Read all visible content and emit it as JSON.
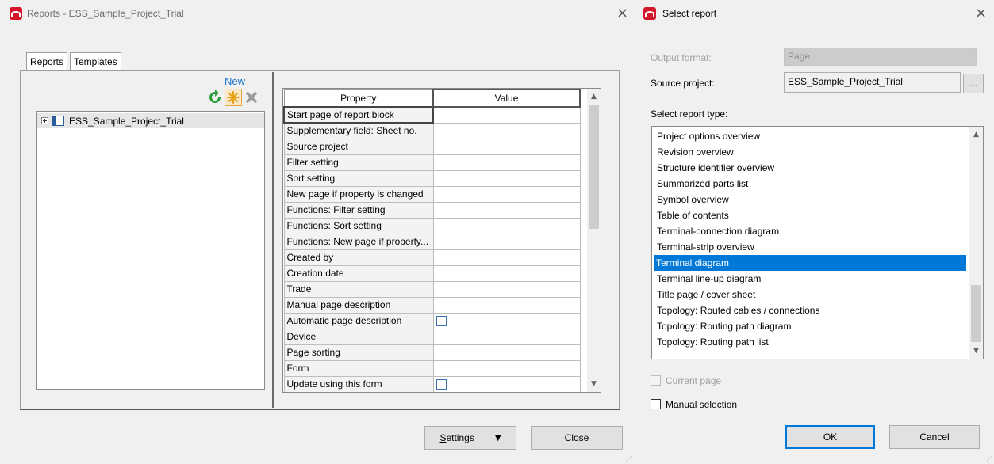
{
  "left_window": {
    "title": "Reports - ESS_Sample_Project_Trial",
    "close_glyph": "×",
    "tabs": [
      "Reports",
      "Templates"
    ],
    "toolbar": {
      "new_label": "New",
      "icons": [
        "refresh-icon",
        "new-star-icon",
        "delete-icon"
      ]
    },
    "tree": {
      "items": [
        {
          "label": "ESS_Sample_Project_Trial",
          "expand_glyph": "plus-box-icon",
          "icon": "project-icon"
        }
      ]
    },
    "grid": {
      "headers": [
        "Property",
        "Value"
      ],
      "rows": [
        {
          "property": "Start page of report block",
          "value": ""
        },
        {
          "property": "Supplementary field: Sheet no.",
          "value": ""
        },
        {
          "property": "Source project",
          "value": ""
        },
        {
          "property": "Filter setting",
          "value": ""
        },
        {
          "property": "Sort setting",
          "value": ""
        },
        {
          "property": "New page if property is changed",
          "value": ""
        },
        {
          "property": "Functions: Filter setting",
          "value": ""
        },
        {
          "property": "Functions: Sort setting",
          "value": ""
        },
        {
          "property": "Functions: New page if property...",
          "value": ""
        },
        {
          "property": "Created by",
          "value": ""
        },
        {
          "property": "Creation date",
          "value": ""
        },
        {
          "property": "Trade",
          "value": ""
        },
        {
          "property": "Manual page description",
          "value": ""
        },
        {
          "property": "Automatic page description",
          "value": "checkbox"
        },
        {
          "property": "Device",
          "value": ""
        },
        {
          "property": "Page sorting",
          "value": ""
        },
        {
          "property": "Form",
          "value": ""
        },
        {
          "property": "Update using this form",
          "value": "checkbox"
        }
      ]
    },
    "buttons": {
      "settings": "Settings",
      "settings_mnemonic": "S",
      "settings_rest": "ettings",
      "settings_arrow": "▼",
      "close": "Close"
    }
  },
  "right_window": {
    "title": "Select report",
    "close_glyph": "×",
    "output_format_label": "Output format:",
    "output_format_value": "Page",
    "source_project_label": "Source project:",
    "source_project_value": "ESS_Sample_Project_Trial",
    "browse_label": "...",
    "report_type_label": "Select report type:",
    "report_types": [
      "Project options overview",
      "Revision overview",
      "Structure identifier overview",
      "Summarized parts list",
      "Symbol overview",
      "Table of contents",
      "Terminal-connection diagram",
      "Terminal-strip overview",
      "Terminal diagram",
      "Terminal line-up diagram",
      "Title page / cover sheet",
      "Topology: Routed cables / connections",
      "Topology: Routing path diagram",
      "Topology: Routing path list"
    ],
    "selected_report_type": "Terminal diagram",
    "current_page_label": "Current page",
    "current_page_checked": false,
    "manual_selection_label": "Manual selection",
    "manual_selection_checked": false,
    "ok_label": "OK",
    "cancel_label": "Cancel"
  },
  "colors": {
    "accent": "#0078d7",
    "app_icon": "#d5162a",
    "new_label": "#1a74c9"
  }
}
